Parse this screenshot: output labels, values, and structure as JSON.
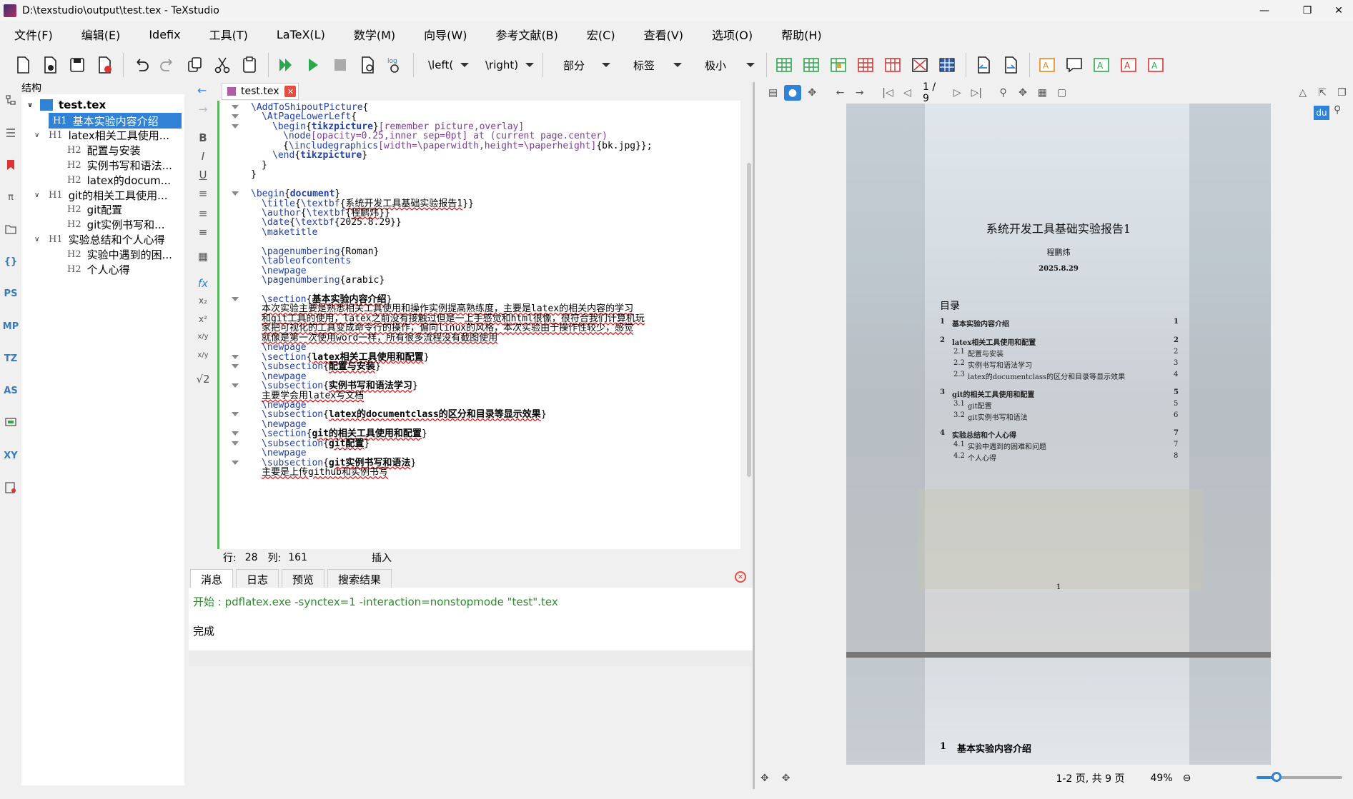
{
  "window": {
    "title": "D:\\texstudio\\output\\test.tex - TeXstudio"
  },
  "menu": [
    "文件(F)",
    "编辑(E)",
    "Idefix",
    "工具(T)",
    "LaTeX(L)",
    "数学(M)",
    "向导(W)",
    "参考文献(B)",
    "宏(C)",
    "查看(V)",
    "选项(O)",
    "帮助(H)"
  ],
  "toolbar": {
    "left_combo": "\\left(",
    "right_combo": "\\right)",
    "section_combo": "部分",
    "label_combo": "标签",
    "size_combo": "极小"
  },
  "structure": {
    "title": "结构",
    "root": "test.tex",
    "items": [
      {
        "level": "H1",
        "label": "基本实验内容介绍",
        "selected": true
      },
      {
        "level": "H1",
        "label": "latex相关工具使用..."
      },
      {
        "level": "H2",
        "label": "配置与安装"
      },
      {
        "level": "H2",
        "label": "实例书写和语法..."
      },
      {
        "level": "H2",
        "label": "latex的docum..."
      },
      {
        "level": "H1",
        "label": "git的相关工具使用..."
      },
      {
        "level": "H2",
        "label": "git配置"
      },
      {
        "level": "H2",
        "label": "git实例书写和..."
      },
      {
        "level": "H1",
        "label": "实验总结和个人心得"
      },
      {
        "level": "H2",
        "label": "实验中遇到的困..."
      },
      {
        "level": "H2",
        "label": "个人心得"
      }
    ]
  },
  "side_icons": [
    "PS",
    "MP",
    "TZ",
    "AS",
    "XY"
  ],
  "editor": {
    "tab": "test.tex",
    "format_buttons": [
      "B",
      "I",
      "U"
    ],
    "math_buttons": [
      "fx",
      "x₂",
      "x²",
      "x/y",
      "x/y",
      "√2"
    ],
    "status": {
      "line_label": "行:",
      "line": "28",
      "col_label": "列:",
      "col": "161",
      "mode": "插入"
    }
  },
  "messages": {
    "tabs": [
      "消息",
      "日志",
      "预览",
      "搜索结果"
    ],
    "start": "开始 : pdflatex.exe -synctex=1 -interaction=nonstopmode \"test\".tex",
    "done": "完成"
  },
  "viewer": {
    "page_indicator": "1 / 9",
    "pdf_title": "系统开发工具基础实验报告1",
    "pdf_author": "程鹏炜",
    "pdf_date": "2025.8.29",
    "toc_heading": "目录",
    "toc": [
      {
        "num": "1",
        "text": "基本实验内容介绍",
        "page": "1",
        "bold": true
      },
      {
        "num": "2",
        "text": "latex相关工具使用和配置",
        "page": "2",
        "bold": true
      },
      {
        "num": "2.1",
        "text": "配置与安装",
        "page": "2"
      },
      {
        "num": "2.2",
        "text": "实例书写和语法学习",
        "page": "3"
      },
      {
        "num": "2.3",
        "text": "latex的documentclass的区分和目录等显示效果",
        "page": "4"
      },
      {
        "num": "3",
        "text": "git的相关工具使用和配置",
        "page": "5",
        "bold": true
      },
      {
        "num": "3.1",
        "text": "git配置",
        "page": "5"
      },
      {
        "num": "3.2",
        "text": "git实例书写和语法",
        "page": "6"
      },
      {
        "num": "4",
        "text": "实验总结和个人心得",
        "page": "7",
        "bold": true
      },
      {
        "num": "4.1",
        "text": "实验中遇到的困难和问题",
        "page": "7"
      },
      {
        "num": "4.2",
        "text": "个人心得",
        "page": "8"
      }
    ],
    "page_number": "1",
    "page2_heading_num": "1",
    "page2_heading": "基本实验内容介绍",
    "du_label": "du",
    "pages_status": "1-2 页, 共 9 页",
    "zoom": "49%",
    "zoom_level": 0.23
  },
  "code_lines": [
    {
      "y": 0,
      "indent": 0,
      "parts": [
        [
          "kw",
          "\\AddToShipoutPicture"
        ],
        [
          "",
          "{"
        ]
      ]
    },
    {
      "y": 1,
      "indent": 2,
      "parts": [
        [
          "kw",
          "\\AtPageLowerLeft"
        ],
        [
          "",
          "{"
        ]
      ]
    },
    {
      "y": 2,
      "indent": 4,
      "parts": [
        [
          "kw",
          "\\begin"
        ],
        [
          "",
          "{"
        ],
        [
          "kwb",
          "tikzpicture"
        ],
        [
          "",
          "}"
        ],
        [
          "opt",
          "[remember picture,overlay]"
        ]
      ]
    },
    {
      "y": 3,
      "indent": 6,
      "parts": [
        [
          "kw",
          "\\node"
        ],
        [
          "opt",
          "[opacity=0.25,inner sep=0pt] at (current page.center)"
        ]
      ]
    },
    {
      "y": 4,
      "indent": 6,
      "parts": [
        [
          "",
          "{"
        ],
        [
          "kw",
          "\\includegraphics"
        ],
        [
          "opt",
          "[width=\\paperwidth,height=\\paperheight]"
        ],
        [
          "",
          "{bk.jpg}};"
        ]
      ]
    },
    {
      "y": 5,
      "indent": 4,
      "parts": [
        [
          "kw",
          "\\end"
        ],
        [
          "",
          "{"
        ],
        [
          "kwb",
          "tikzpicture"
        ],
        [
          "",
          "}"
        ]
      ]
    },
    {
      "y": 6,
      "indent": 2,
      "parts": [
        [
          "",
          "}"
        ]
      ]
    },
    {
      "y": 7,
      "indent": 0,
      "parts": [
        [
          "",
          "}"
        ]
      ]
    },
    {
      "y": 9,
      "indent": 0,
      "parts": [
        [
          "kw",
          "\\begin"
        ],
        [
          "",
          "{"
        ],
        [
          "kwb",
          "document"
        ],
        [
          "",
          "}"
        ]
      ]
    },
    {
      "y": 10,
      "indent": 2,
      "parts": [
        [
          "kw",
          "\\title"
        ],
        [
          "",
          "{"
        ],
        [
          "kw",
          "\\textbf"
        ],
        [
          "",
          "{"
        ],
        [
          "ul",
          "系统开发工具基础实验报告1"
        ],
        [
          "",
          "}}"
        ]
      ]
    },
    {
      "y": 11,
      "indent": 2,
      "parts": [
        [
          "kw",
          "\\author"
        ],
        [
          "",
          "{"
        ],
        [
          "kw",
          "\\textbf"
        ],
        [
          "",
          "{"
        ],
        [
          "ul",
          "程鹏炜"
        ],
        [
          "",
          "}}"
        ]
      ]
    },
    {
      "y": 12,
      "indent": 2,
      "parts": [
        [
          "kw",
          "\\date"
        ],
        [
          "",
          "{"
        ],
        [
          "kw",
          "\\textbf"
        ],
        [
          "",
          "{2025.8.29}}"
        ]
      ]
    },
    {
      "y": 13,
      "indent": 2,
      "parts": [
        [
          "kw",
          "\\maketitle"
        ]
      ]
    },
    {
      "y": 15,
      "indent": 2,
      "parts": [
        [
          "kw",
          "\\pagenumbering"
        ],
        [
          "",
          "{Roman}"
        ]
      ]
    },
    {
      "y": 16,
      "indent": 2,
      "parts": [
        [
          "kw",
          "\\tableofcontents"
        ]
      ]
    },
    {
      "y": 17,
      "indent": 2,
      "parts": [
        [
          "kw",
          "\\newpage"
        ]
      ]
    },
    {
      "y": 18,
      "indent": 2,
      "parts": [
        [
          "kw",
          "\\pagenumbering"
        ],
        [
          "",
          "{arabic}"
        ]
      ]
    },
    {
      "y": 20,
      "indent": 2,
      "parts": [
        [
          "kw",
          "\\section"
        ],
        [
          "",
          "{"
        ],
        [
          "bul",
          "基本实验内容介绍"
        ],
        [
          "",
          "}"
        ]
      ]
    },
    {
      "y": 21,
      "indent": 2,
      "parts": [
        [
          "ul",
          "本次实验主要是熟悉相关工具使用和操作实例提高熟练度，主要是latex的相关内容的学习"
        ]
      ]
    },
    {
      "y": 22,
      "indent": 2,
      "parts": [
        [
          "ul",
          "和git工具的使用，latex之前没有接触过但是一上手感觉和html很像，很符合我们计算机玩"
        ]
      ]
    },
    {
      "y": 23,
      "indent": 2,
      "parts": [
        [
          "ul",
          "家把可视化的工具变成命令行的操作，偏向linux的风格，本次实验由于操作性较少，感觉"
        ]
      ]
    },
    {
      "y": 24,
      "indent": 2,
      "parts": [
        [
          "ul",
          "就像是第一次使用word一样，所有很多流程没有截图使用"
        ]
      ]
    },
    {
      "y": 25,
      "indent": 2,
      "parts": [
        [
          "kw",
          "\\newpage"
        ]
      ]
    },
    {
      "y": 26,
      "indent": 2,
      "parts": [
        [
          "kw",
          "\\section"
        ],
        [
          "",
          "{"
        ],
        [
          "bul",
          "latex相关工具使用和配置"
        ],
        [
          "",
          "}"
        ]
      ]
    },
    {
      "y": 27,
      "indent": 2,
      "parts": [
        [
          "kw",
          "\\subsection"
        ],
        [
          "",
          "{"
        ],
        [
          "bul",
          "配置与安装"
        ],
        [
          "",
          "}"
        ]
      ]
    },
    {
      "y": 28,
      "indent": 2,
      "parts": [
        [
          "kw",
          "\\newpage"
        ]
      ]
    },
    {
      "y": 29,
      "indent": 2,
      "parts": [
        [
          "kw",
          "\\subsection"
        ],
        [
          "",
          "{"
        ],
        [
          "bul",
          "实例书写和语法学习"
        ],
        [
          "",
          "}"
        ]
      ]
    },
    {
      "y": 30,
      "indent": 2,
      "parts": [
        [
          "ul",
          "主要学会用latex写文档"
        ]
      ]
    },
    {
      "y": 31,
      "indent": 2,
      "parts": [
        [
          "kw",
          "\\newpage"
        ]
      ]
    },
    {
      "y": 32,
      "indent": 2,
      "parts": [
        [
          "kw",
          "\\subsection"
        ],
        [
          "",
          "{"
        ],
        [
          "bul",
          "latex的documentclass的区分和目录等显示效果"
        ],
        [
          "",
          "}"
        ]
      ]
    },
    {
      "y": 33,
      "indent": 2,
      "parts": [
        [
          "kw",
          "\\newpage"
        ]
      ]
    },
    {
      "y": 34,
      "indent": 2,
      "parts": [
        [
          "kw",
          "\\section"
        ],
        [
          "",
          "{"
        ],
        [
          "bul",
          "git的相关工具使用和配置"
        ],
        [
          "",
          "}"
        ]
      ]
    },
    {
      "y": 35,
      "indent": 2,
      "parts": [
        [
          "kw",
          "\\subsection"
        ],
        [
          "",
          "{"
        ],
        [
          "bul",
          "git配置"
        ],
        [
          "",
          "}"
        ]
      ]
    },
    {
      "y": 36,
      "indent": 2,
      "parts": [
        [
          "kw",
          "\\newpage"
        ]
      ]
    },
    {
      "y": 37,
      "indent": 2,
      "parts": [
        [
          "kw",
          "\\subsection"
        ],
        [
          "",
          "{"
        ],
        [
          "bul",
          "git实例书写和语法"
        ],
        [
          "",
          "}"
        ]
      ]
    },
    {
      "y": 38,
      "indent": 2,
      "parts": [
        [
          "ul",
          "主要是上传github和实例书写"
        ]
      ]
    }
  ]
}
